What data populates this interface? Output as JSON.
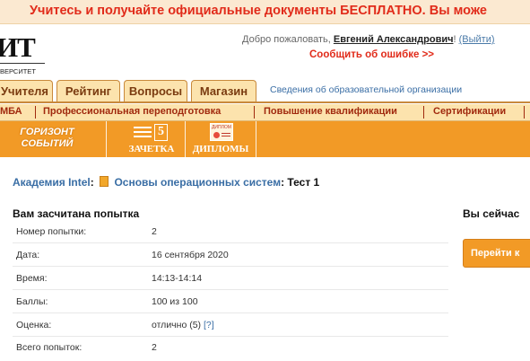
{
  "banner": {
    "text": "Учитесь и получайте официальные документы БЕСПЛАТНО. Вы може"
  },
  "logo": {
    "text": "ИТ",
    "subtitle": "ВЕРСИТЕТ"
  },
  "header": {
    "welcome_prefix": "Добро пожаловать,",
    "user_name": "Евгений Александрович",
    "welcome_suffix": "!",
    "logout": "(Выйти)",
    "report_error": "Сообщить об ошибке >>"
  },
  "tabs": [
    {
      "label": "Учителя"
    },
    {
      "label": "Рейтинг"
    },
    {
      "label": "Вопросы"
    },
    {
      "label": "Магазин"
    }
  ],
  "org_link": "Сведения об образовательной организации",
  "categories": [
    {
      "label": "МБА"
    },
    {
      "label": "Профессиональная переподготовка"
    },
    {
      "label": "Повышение квалификации"
    },
    {
      "label": "Сертификации"
    }
  ],
  "orange_bar": {
    "horizon_line1": "ГОРИЗОНТ",
    "horizon_line2": "СОБЫТИЙ",
    "zachetka_icon_text": "5",
    "zachetka_label": "ЗАЧЕТКА",
    "diplomas_icon_text": "ДИПЛОМ",
    "diplomas_label": "ДИПЛОМЫ"
  },
  "breadcrumb": {
    "academy": "Академия Intel",
    "colon1": ":",
    "course": "Основы операционных систем",
    "colon2": ":",
    "test": "Тест 1"
  },
  "result": {
    "title": "Вам засчитана попытка",
    "rows": [
      {
        "label": "Номер попытки:",
        "value": "2"
      },
      {
        "label": "Дата:",
        "value": "16 сентября 2020"
      },
      {
        "label": "Время:",
        "value": "14:13-14:14"
      },
      {
        "label": "Баллы:",
        "value": "100 из 100"
      },
      {
        "label": "Оценка:",
        "value": "отлично (5)",
        "help": "[?]"
      },
      {
        "label": "Всего попыток:",
        "value": "2"
      }
    ]
  },
  "right_panel": {
    "title": "Вы сейчас",
    "button": "Перейти к"
  },
  "colors": {
    "accent_orange": "#f29a26",
    "banner_red": "#e12b1a",
    "link_blue": "#3a6ea5",
    "tab_bg": "#fce3ad",
    "category_text": "#a0290e"
  }
}
